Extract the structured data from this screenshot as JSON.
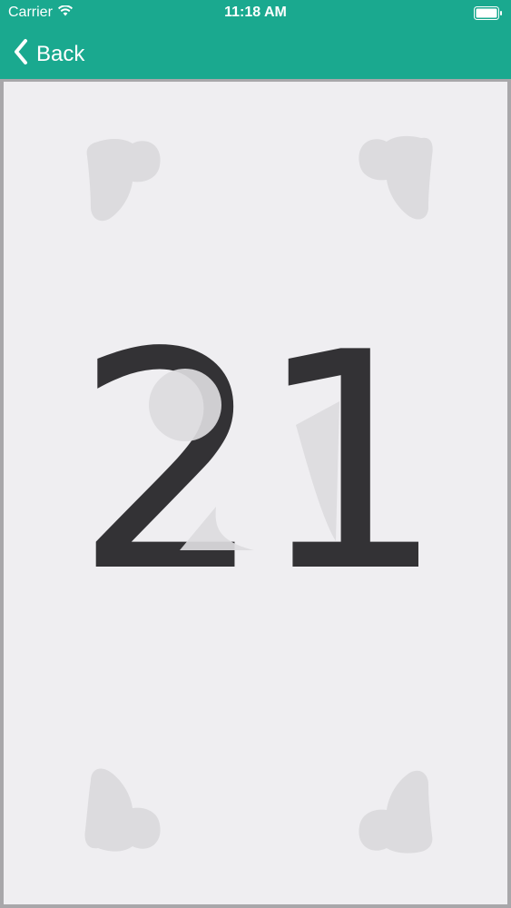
{
  "status_bar": {
    "carrier": "Carrier",
    "time": "11:18 AM",
    "icons": [
      "wifi-icon",
      "battery-icon"
    ]
  },
  "nav_bar": {
    "back_label": "Back",
    "back_icon": "chevron-left-icon"
  },
  "card": {
    "value": "21",
    "suit_icon": "heart-icon",
    "colors": {
      "nav_background": "#1aa98f",
      "card_background": "#efeef1",
      "card_border": "#a8a7aa",
      "value_text": "#333235",
      "suit_ghost": "#dcdbde"
    }
  }
}
